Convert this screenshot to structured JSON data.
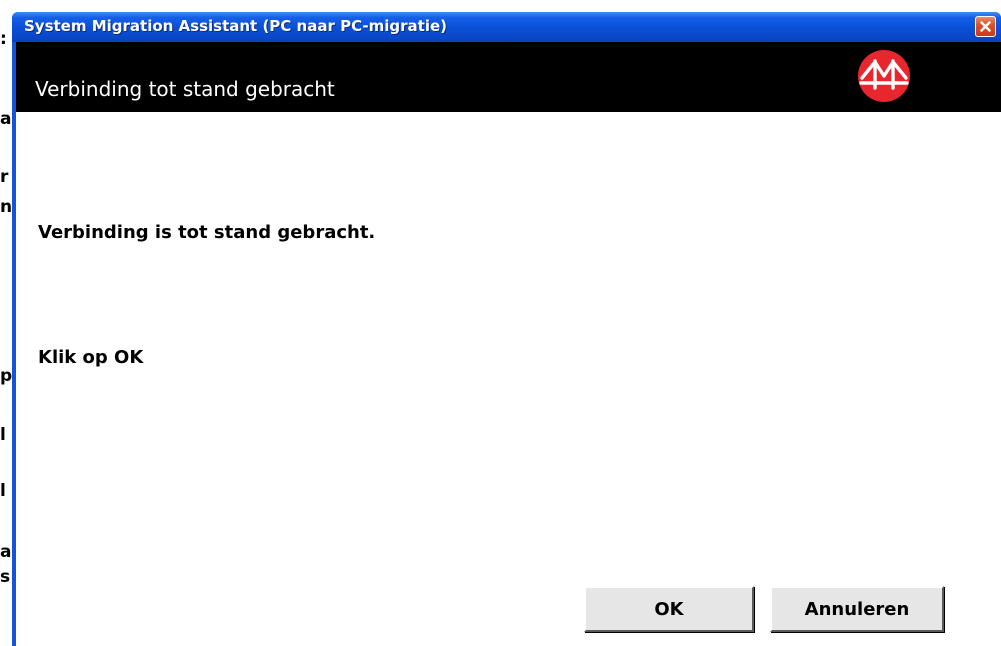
{
  "window": {
    "title": "System Migration Assistant (PC naar PC-migratie)"
  },
  "banner": {
    "title": "Verbinding tot stand gebracht"
  },
  "content": {
    "message": "Verbinding is tot stand gebracht.",
    "instruction": "Klik op OK"
  },
  "buttons": {
    "ok_label": "OK",
    "cancel_label": "Annuleren"
  },
  "background_fragments": [
    ":",
    "a",
    "r",
    "n",
    "p",
    "l",
    "l",
    "a",
    "s"
  ],
  "icons": {
    "close": "close-icon",
    "logo": "sma-bridge-logo"
  },
  "colors": {
    "titlebar": "#0b4ed6",
    "banner": "#000000",
    "logo": "#e8262e",
    "close_button": "#d9542b"
  }
}
